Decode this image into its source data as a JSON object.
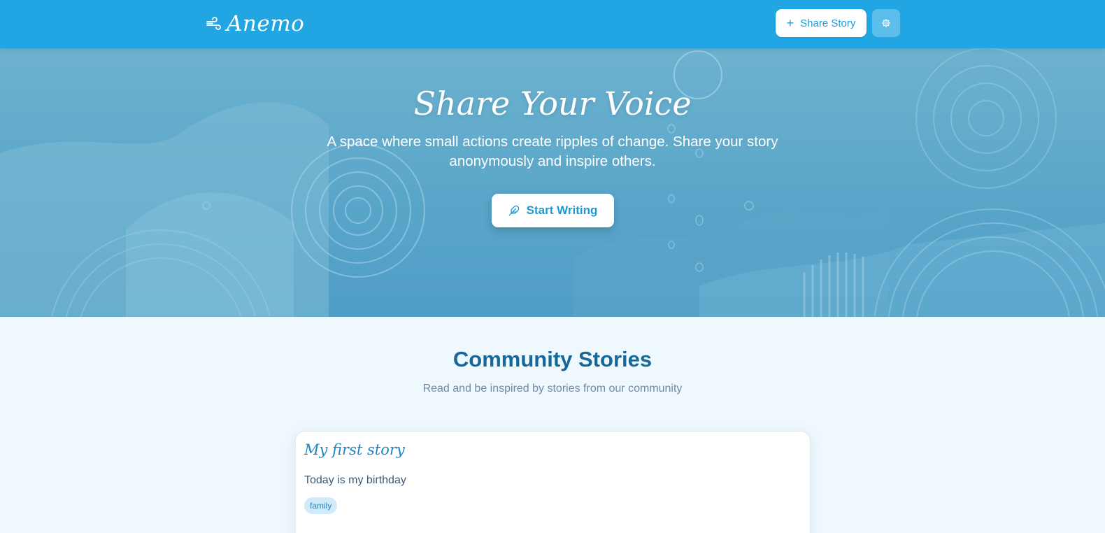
{
  "header": {
    "brand_name": "Anemo",
    "brand_icon": "wind-icon",
    "share_button_label": "Share Story",
    "share_button_icon": "plus-icon",
    "settings_icon": "gear-icon"
  },
  "hero": {
    "title": "Share Your Voice",
    "subtitle": "A space where small actions create ripples of change. Share your story anonymously and inspire others.",
    "cta_label": "Start Writing",
    "cta_icon": "feather-icon"
  },
  "community": {
    "title": "Community Stories",
    "subtitle": "Read and be inspired by stories from our community",
    "stories": [
      {
        "title": "My first story",
        "body": "Today is my birthday",
        "tags": [
          "family"
        ]
      }
    ]
  },
  "colors": {
    "header": "#21a5e3",
    "accent": "#1c9ad6",
    "section_title": "#16679a",
    "page_background": "#eff8fd",
    "tag_background": "#cfeaf8"
  }
}
